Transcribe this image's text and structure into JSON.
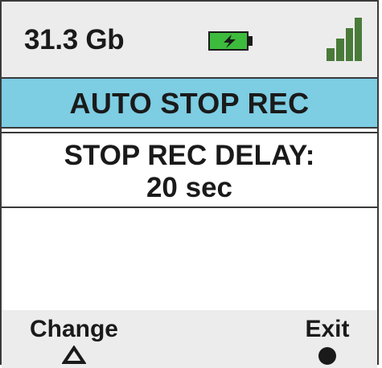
{
  "status_bar": {
    "storage": "31.3 Gb",
    "battery_icon": "battery-charging-icon",
    "signal_icon": "signal-strength-icon",
    "battery_color": "#3dbb3d",
    "signal_color": "#4a7a3a"
  },
  "title_bar": {
    "title": "AUTO STOP REC",
    "background": "#7dcde3"
  },
  "setting": {
    "label": "STOP REC DELAY:",
    "value": "20 sec"
  },
  "softkeys": {
    "left": {
      "label": "Change",
      "icon": "triangle-up-icon"
    },
    "right": {
      "label": "Exit",
      "icon": "filled-circle-icon"
    }
  }
}
